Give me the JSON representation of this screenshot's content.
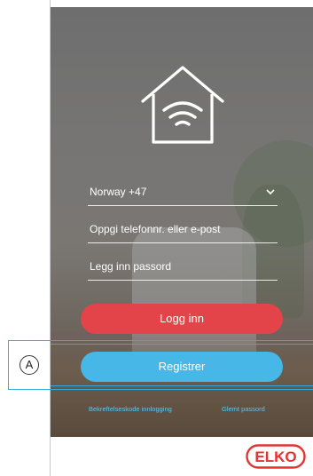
{
  "login": {
    "country": "Norway +47",
    "phone_placeholder": "Oppgi telefonnr. eller e-post",
    "password_placeholder": "Legg inn passord",
    "login_label": "Logg inn",
    "register_label": "Registrer",
    "verification_link": "Bekreftelseskode innlogging",
    "forgot_link": "Glemt passord"
  },
  "callout": {
    "label": "A"
  },
  "brand": {
    "logo_text": "ELKO"
  },
  "colors": {
    "login_button": "#e2444a",
    "register_button": "#46b7e6",
    "link": "#5fc6ef",
    "callout": "#3aa9e0",
    "elko_red": "#e2332f"
  },
  "icons": {
    "app_logo": "house-wifi-icon",
    "country_picker": "chevron-down-icon"
  }
}
